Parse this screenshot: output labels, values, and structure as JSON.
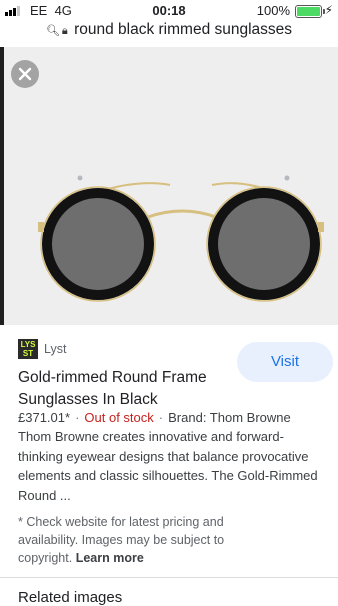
{
  "status_bar": {
    "carrier": "EE",
    "network": "4G",
    "time": "00:18",
    "battery_percent": "100%",
    "signal_bars": 4,
    "signal_bars_filled": 3,
    "battery_level": 1.0,
    "battery_color": "#4cd964"
  },
  "address_bar": {
    "search_icon": "search-icon",
    "lock_icon": "lock-icon",
    "query": "round black rimmed sunglasses"
  },
  "viewer": {
    "close_icon": "close-icon",
    "image_subject": "sunglasses-image"
  },
  "result": {
    "source_logo_text_top": "LYS",
    "source_logo_text_bottom": "ST",
    "source_name": "Lyst",
    "visit_label": "Visit",
    "title": "Gold-rimmed Round Frame Sunglasses In Black",
    "price": "£371.01*",
    "separator": "·",
    "stock": "Out of stock",
    "brand": "Brand: Thom Browne",
    "description": "Thom Browne creates innovative and forward-thinking eyewear designs that balance provocative elements and classic silhouettes. The Gold-Rimmed Round ...",
    "disclaimer": "* Check website for latest pricing and availability. Images may be subject to copyright.",
    "learn_more": "Learn more"
  },
  "related": {
    "heading": "Related images"
  },
  "colors": {
    "accent": "#1a73e8",
    "visit_bg": "#e8f0fe",
    "out_of_stock": "#c5221f",
    "image_bg": "#eeeeee"
  }
}
